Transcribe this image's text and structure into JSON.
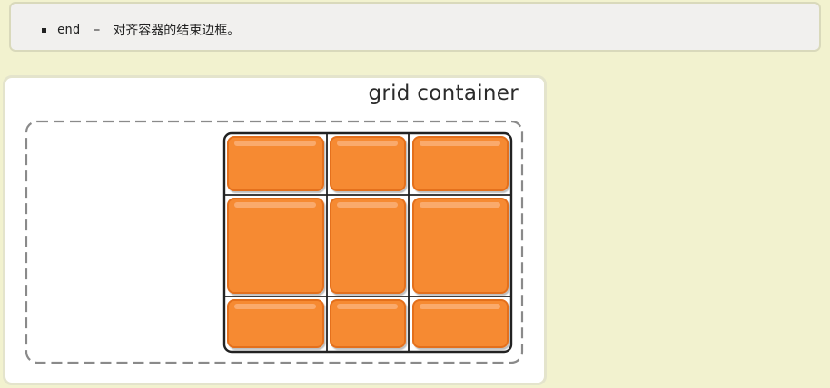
{
  "note": {
    "items": [
      {
        "keyword": "end",
        "separator": "–",
        "description": "对齐容器的结束边框。"
      }
    ]
  },
  "illustration": {
    "title": "grid container",
    "grid": {
      "rows": 3,
      "columns": 3,
      "alignment": "end"
    },
    "colors": {
      "item_fill": "#f68a33",
      "item_stroke": "#e4701a",
      "item_highlight": "#fbb27a",
      "grid_lines": "#222222",
      "container_dash": "#8a8a8a",
      "page_background": "#f2f2cf",
      "card_background": "#ffffff"
    }
  }
}
